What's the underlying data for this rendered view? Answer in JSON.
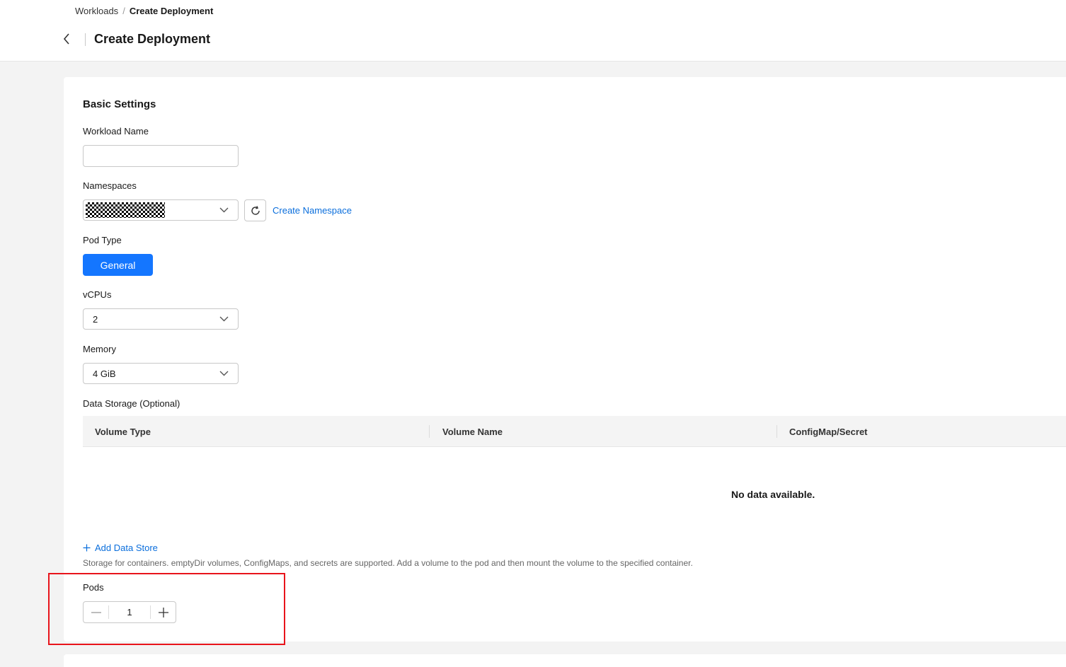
{
  "breadcrumb": {
    "parent": "Workloads",
    "separator": "/",
    "current": "Create Deployment"
  },
  "header": {
    "title": "Create Deployment"
  },
  "basic_settings": {
    "title": "Basic Settings",
    "workload_name": {
      "label": "Workload Name",
      "value": "",
      "placeholder": ""
    },
    "namespaces": {
      "label": "Namespaces",
      "value": "",
      "value_masked": true,
      "create_link": "Create Namespace"
    },
    "pod_type": {
      "label": "Pod Type",
      "selected": "General"
    },
    "vcpus": {
      "label": "vCPUs",
      "value": "2"
    },
    "memory": {
      "label": "Memory",
      "value": "4 GiB"
    },
    "data_storage": {
      "label": "Data Storage (Optional)",
      "columns": [
        "Volume Type",
        "Volume Name",
        "ConfigMap/Secret"
      ],
      "empty_text": "No data available.",
      "add_link": "Add Data Store",
      "hint": "Storage for containers. emptyDir volumes, ConfigMaps, and secrets are supported. Add a volume to the pod and then mount the volume to the specified container."
    },
    "pods": {
      "label": "Pods",
      "value": "1"
    }
  },
  "colors": {
    "accent": "#1476ff",
    "link": "#0a6edc",
    "highlight": "#e8141b"
  },
  "icons": [
    "chevron-left-icon",
    "chevron-down-icon",
    "refresh-icon",
    "plus-icon",
    "minus-icon"
  ]
}
